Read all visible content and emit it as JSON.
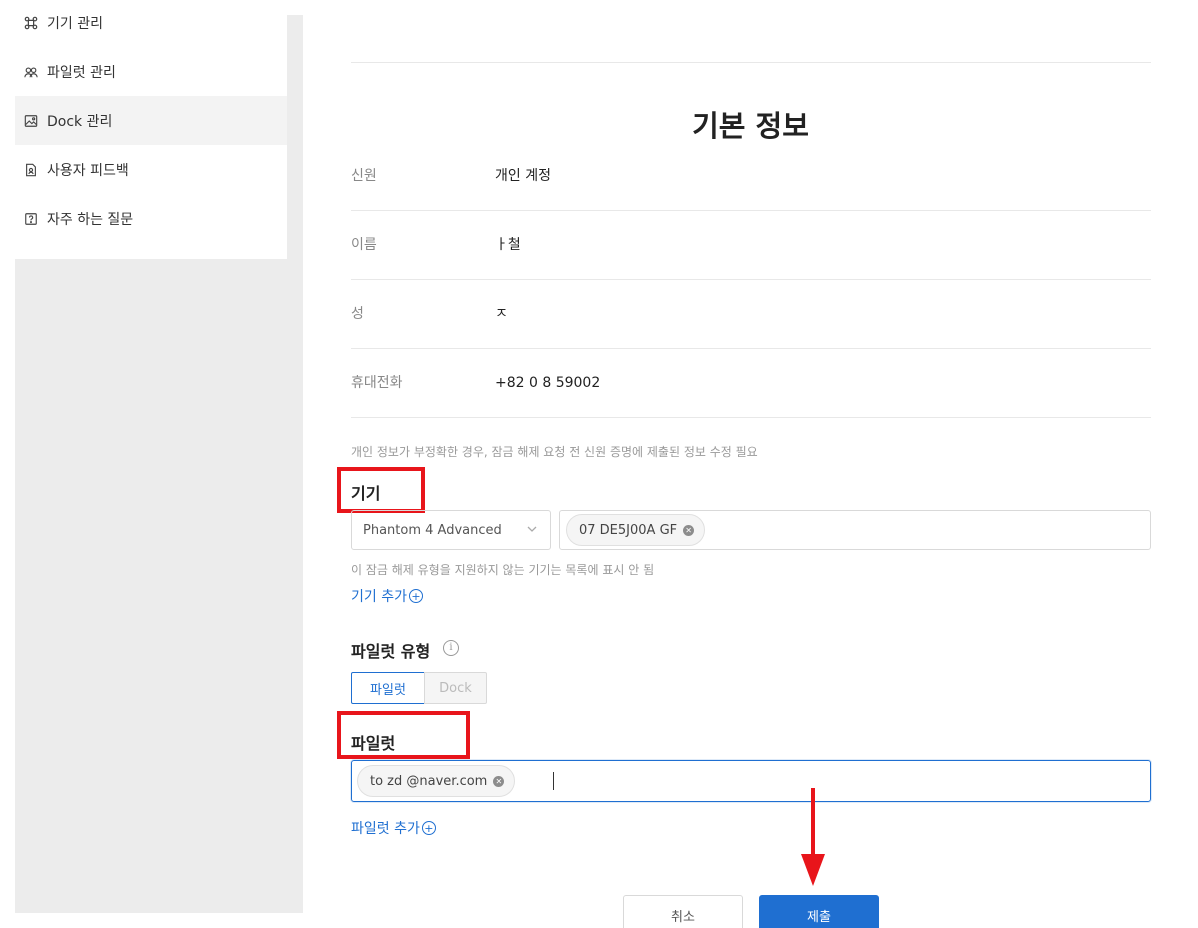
{
  "sidebar": {
    "items": [
      {
        "label": "기기 관리",
        "icon": "command-icon"
      },
      {
        "label": "파일럿 관리",
        "icon": "pilot-group-icon"
      },
      {
        "label": "Dock 관리",
        "icon": "image-icon",
        "active": true
      },
      {
        "label": "사용자 피드백",
        "icon": "feedback-doc-icon"
      },
      {
        "label": "자주 하는 질문",
        "icon": "question-icon"
      }
    ]
  },
  "basic_info": {
    "title": "기본 정보",
    "rows": [
      {
        "label": "신원",
        "value": "개인 계정"
      },
      {
        "label": "이름",
        "value": "ㅏ철"
      },
      {
        "label": "성",
        "value": "ㅈ"
      },
      {
        "label": "휴대전화",
        "value": "+82 0  8  59002"
      }
    ],
    "hint": "개인 정보가 부정확한 경우, 잠금 해제 요청 전 신원 증명에 제출된 정보 수정 필요"
  },
  "device": {
    "title": "기기",
    "model_select": "Phantom 4 Advanced",
    "serial_tag": "07 DE5J00A  GF",
    "hint": "이 잠금 해제 유형을 지원하지 않는 기기는 목록에 표시 안 됨",
    "add_link": "기기 추가"
  },
  "pilot_type": {
    "title": "파일럿 유형",
    "options": [
      "파일럿",
      "Dock"
    ],
    "selected": "파일럿"
  },
  "pilot": {
    "title": "파일럿",
    "email_tag": "to  zd  @naver.com",
    "add_link": "파일럿 추가"
  },
  "footer": {
    "cancel_label": "취소",
    "submit_label": "제출"
  },
  "colors": {
    "accent": "#1f6fd1",
    "highlight": "#e8151b"
  }
}
